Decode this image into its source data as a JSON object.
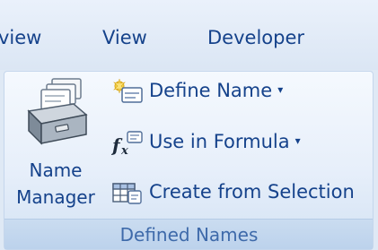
{
  "tabs": [
    {
      "label": "view"
    },
    {
      "label": "View"
    },
    {
      "label": "Developer"
    }
  ],
  "group": {
    "caption": "Defined Names",
    "name_manager": {
      "line1": "Name",
      "line2": "Manager",
      "icon": "name-manager-icon"
    },
    "commands": [
      {
        "label": "Define Name",
        "icon": "define-name-icon",
        "has_dropdown": true
      },
      {
        "label": "Use in Formula",
        "icon": "function-icon",
        "has_dropdown": true
      },
      {
        "label": "Create from Selection",
        "icon": "create-from-selection-icon",
        "has_dropdown": false
      }
    ],
    "dropdown_glyph": "▾"
  },
  "colors": {
    "text": "#15428b",
    "caption": "#3e6aaa",
    "ribbon_bg": "#e7effa"
  }
}
